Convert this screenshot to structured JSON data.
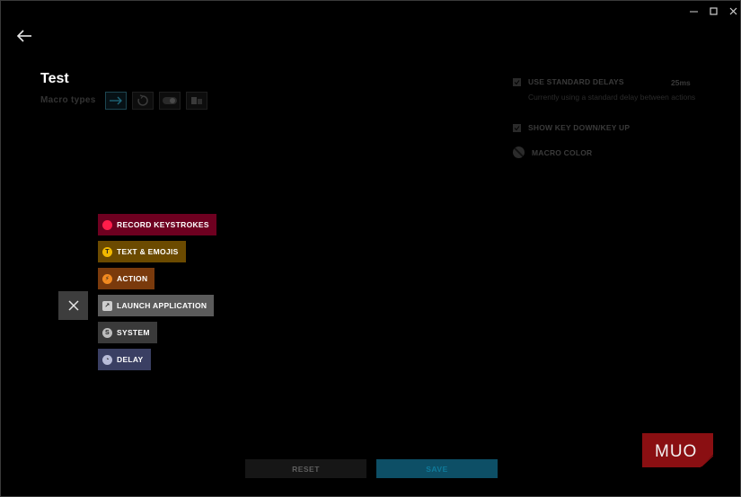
{
  "window": {
    "min_glyph": "—",
    "max_glyph": "☐",
    "close_glyph": "✕"
  },
  "header": {
    "title": "Test",
    "macro_types_label": "Macro types"
  },
  "settings": {
    "standard_delays_label": "USE STANDARD DELAYS",
    "standard_delays_value": "25ms",
    "standard_delays_desc": "Currently using a standard delay between actions",
    "key_down_up_label": "SHOW KEY DOWN/KEY UP",
    "macro_color_label": "MACRO COLOR"
  },
  "menu": {
    "items": [
      {
        "label": "RECORD KEYSTROKES",
        "icon": "record-icon",
        "glyph": "",
        "bg": "#6e0020",
        "icon_bg": "#ff1e4b"
      },
      {
        "label": "TEXT & EMOJIS",
        "icon": "text-icon",
        "glyph": "T",
        "bg": "#6b4a00",
        "icon_bg": "#f2b900"
      },
      {
        "label": "ACTION",
        "icon": "lightning-icon",
        "glyph": "⚡",
        "bg": "#7a3a0c",
        "icon_bg": "#f28a20"
      },
      {
        "label": "LAUNCH APPLICATION",
        "icon": "launch-icon",
        "glyph": "↗",
        "bg": "#5b5b5b",
        "icon_bg": "#cfcfcf"
      },
      {
        "label": "SYSTEM",
        "icon": "system-icon",
        "glyph": "S",
        "bg": "#3a3a3a",
        "icon_bg": "#bdbdbd"
      },
      {
        "label": "DELAY",
        "icon": "clock-icon",
        "glyph": "◔",
        "bg": "#3a3f63",
        "icon_bg": "#b8bcd8"
      }
    ]
  },
  "buttons": {
    "reset": "RESET",
    "save": "SAVE"
  },
  "logo": {
    "text": "MUO"
  }
}
